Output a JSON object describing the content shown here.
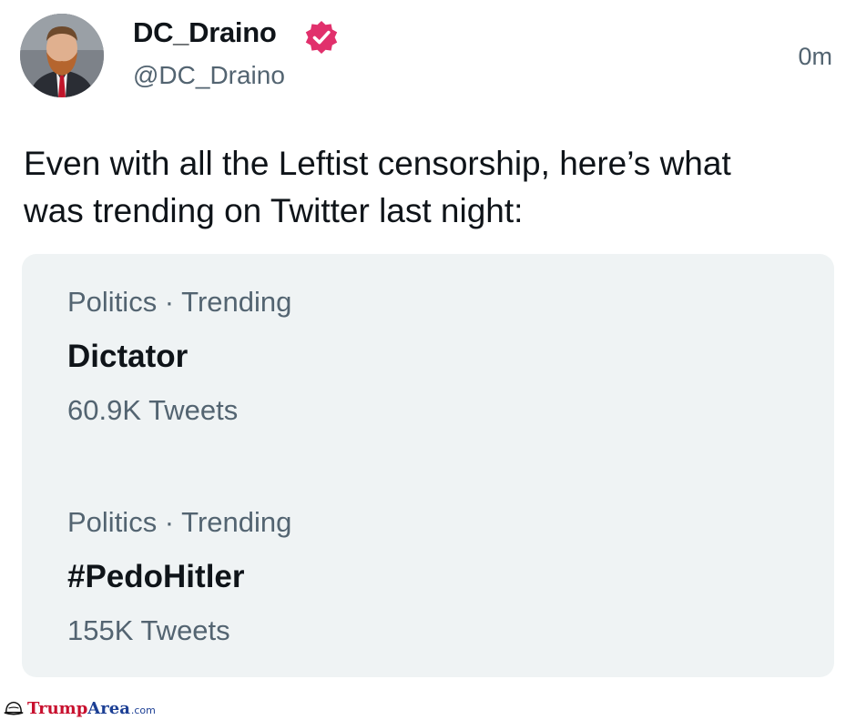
{
  "author": {
    "display_name": "DC_Draino",
    "handle": "@DC_Draino",
    "verified_icon": "verified-badge-icon",
    "verified_color": "#e1306c"
  },
  "timestamp": "0m",
  "tweet": {
    "lines": [
      "Even with all the Leftist censorship, here’s what",
      "was trending on Twitter last night:"
    ]
  },
  "trends": [
    {
      "meta": "Politics · Trending",
      "name": "Dictator",
      "count": "60.9K Tweets"
    },
    {
      "meta": "Politics · Trending",
      "name": "#PedoHitler",
      "count": "155K Tweets"
    }
  ],
  "watermark": {
    "icon": "hat-icon",
    "part1": "Trump",
    "part2": "Area",
    "part3": ".com",
    "color_primary": "#c8102e",
    "color_secondary": "#1c3f94"
  },
  "colors": {
    "text_primary": "#0f1419",
    "text_secondary": "#536471",
    "card_background": "#eff3f4"
  }
}
